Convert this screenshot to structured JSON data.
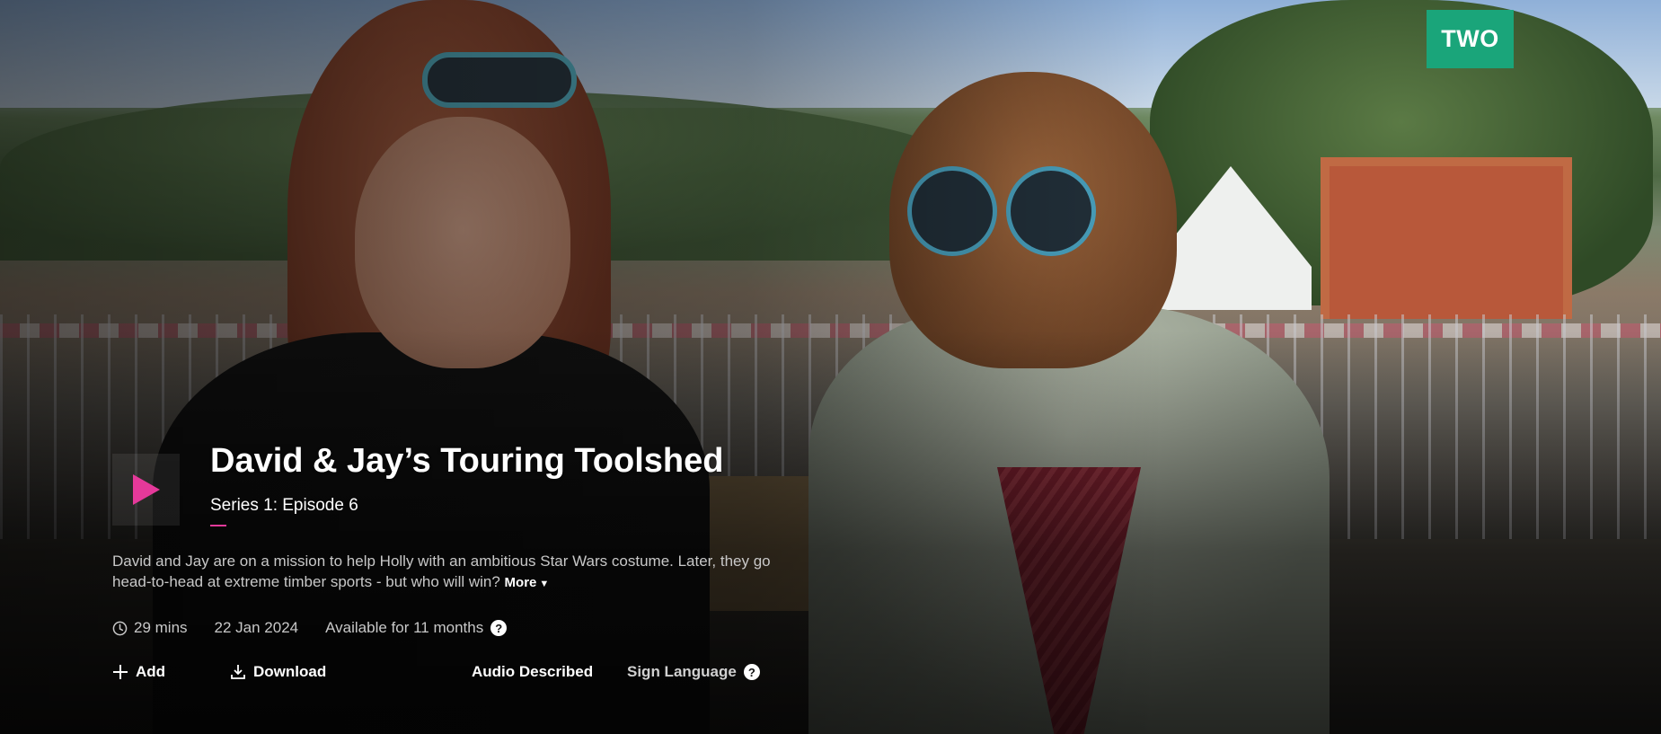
{
  "channel": {
    "label": "TWO",
    "color": "#1aa57a"
  },
  "programme": {
    "title": "David & Jay’s Touring Toolshed",
    "episode": "Series 1: Episode 6",
    "progress_fraction": 0.03,
    "description": "David and Jay are on a mission to help Holly with an ambitious Star Wars costume. Later, they go head-to-head at extreme timber sports - but who will win?",
    "more_label": "More"
  },
  "meta": {
    "duration": "29 mins",
    "date": "22 Jan 2024",
    "availability": "Available for 11 months"
  },
  "actions": {
    "add": "Add",
    "download": "Download",
    "audio_described": "Audio Described",
    "sign_language": "Sign Language"
  },
  "icons": {
    "play": "play-icon",
    "clock": "clock-icon",
    "help": "help-icon",
    "add": "plus-icon",
    "download": "download-icon",
    "more": "chevron-down-icon"
  },
  "colors": {
    "accent": "#e5399a",
    "text_muted": "#c8c8c8"
  }
}
